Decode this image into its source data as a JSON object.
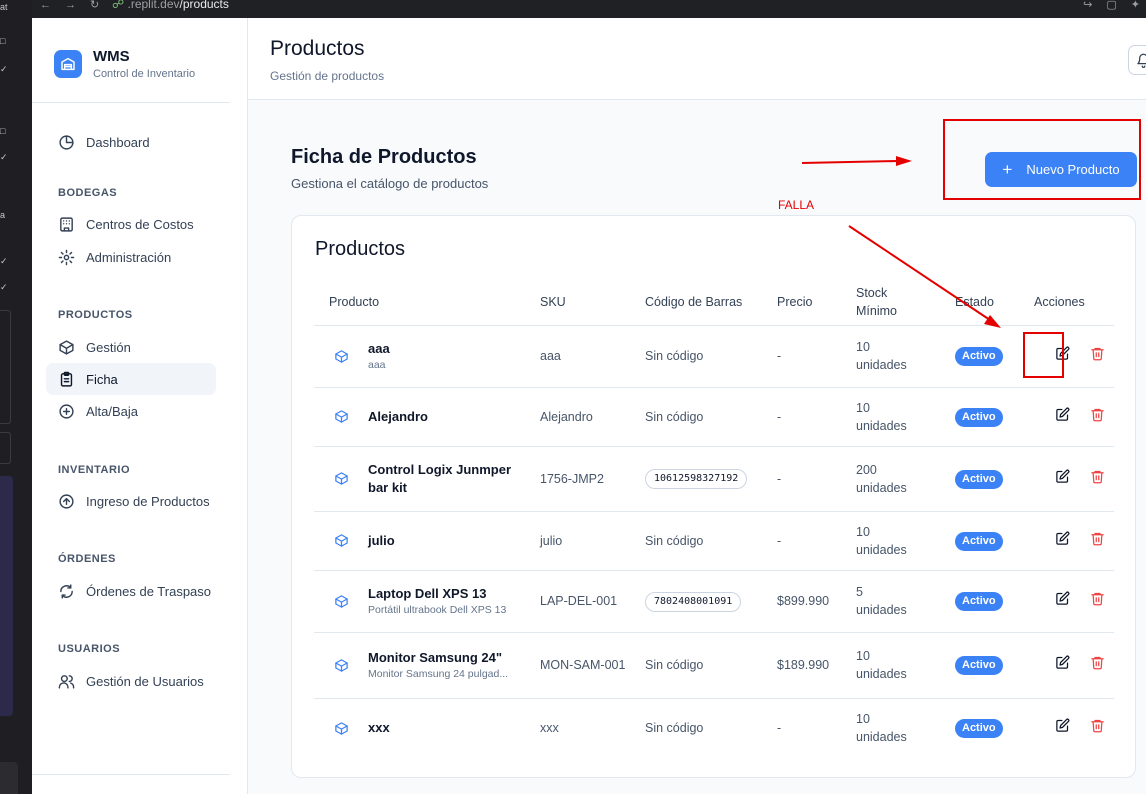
{
  "browser": {
    "url_host": ".replit.dev",
    "url_path": "/products"
  },
  "os_strip": {
    "mark_top": "at",
    "mark_mid": "a"
  },
  "sidebar": {
    "brand_title": "WMS",
    "brand_subtitle": "Control de Inventario",
    "dashboard": "Dashboard",
    "sections": {
      "bodegas": "BODEGAS",
      "productos": "PRODUCTOS",
      "inventario": "INVENTARIO",
      "ordenes": "ÓRDENES",
      "usuarios": "USUARIOS"
    },
    "items": {
      "centros": "Centros de Costos",
      "administracion": "Administración",
      "gestion": "Gestión",
      "ficha": "Ficha",
      "alta_baja": "Alta/Baja",
      "ingreso": "Ingreso de Productos",
      "ordenes_traspaso": "Órdenes de Traspaso",
      "gestion_usuarios": "Gestión de Usuarios"
    }
  },
  "header": {
    "title": "Productos",
    "subtitle": "Gestión de productos"
  },
  "content": {
    "title": "Ficha de Productos",
    "subtitle": "Gestiona el catálogo de productos",
    "new_button": "Nuevo Producto",
    "new_button_icon": "+",
    "card_title": "Productos"
  },
  "table": {
    "headers": {
      "producto": "Producto",
      "sku": "SKU",
      "barcode": "Código de Barras",
      "precio": "Precio",
      "stock": "Stock Mínimo",
      "estado": "Estado",
      "acciones": "Acciones"
    },
    "rows": [
      {
        "name": "aaa",
        "desc": "aaa",
        "sku": "aaa",
        "barcode": "Sin código",
        "price": "-",
        "stock": "10 unidades",
        "status": "Activo"
      },
      {
        "name": "Alejandro",
        "desc": "",
        "sku": "Alejandro",
        "barcode": "Sin código",
        "price": "-",
        "stock": "10 unidades",
        "status": "Activo"
      },
      {
        "name": "Control Logix Junmper bar kit",
        "desc": "",
        "sku": "1756-JMP2",
        "barcode": "10612598327192",
        "price": "-",
        "stock": "200 unidades",
        "status": "Activo"
      },
      {
        "name": "julio",
        "desc": "",
        "sku": "julio",
        "barcode": "Sin código",
        "price": "-",
        "stock": "10 unidades",
        "status": "Activo"
      },
      {
        "name": "Laptop Dell XPS 13",
        "desc": "Portátil ultrabook Dell XPS 13",
        "sku": "LAP-DEL-001",
        "barcode": "7802408001091",
        "price": "$899.990",
        "stock": "5 unidades",
        "status": "Activo"
      },
      {
        "name": "Monitor Samsung 24\"",
        "desc": "Monitor Samsung 24 pulgad...",
        "sku": "MON-SAM-001",
        "barcode": "Sin código",
        "price": "$189.990",
        "stock": "10 unidades",
        "status": "Activo"
      },
      {
        "name": "xxx",
        "desc": "",
        "sku": "xxx",
        "barcode": "Sin código",
        "price": "-",
        "stock": "10 unidades",
        "status": "Activo"
      }
    ]
  },
  "annotation": {
    "label": "FALLA",
    "color": "#e50000"
  },
  "colors": {
    "primary": "#3b82f6",
    "danger": "#ef4444",
    "annotation": "#e50000"
  }
}
